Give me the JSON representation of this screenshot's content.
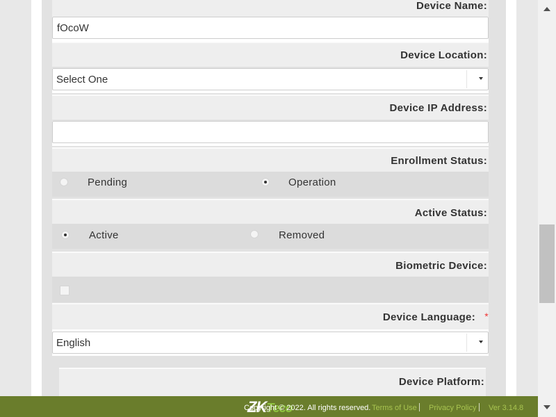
{
  "form": {
    "device_name": {
      "label": "Device Name:",
      "value": "fOcoW"
    },
    "device_location": {
      "label": "Device Location:",
      "selected": "Select One"
    },
    "device_ip": {
      "label": "Device IP Address:",
      "value": "",
      "placeholder": ""
    },
    "enrollment_status": {
      "label": "Enrollment Status:",
      "options": [
        "Pending",
        "Operation"
      ],
      "selected": "Operation"
    },
    "active_status": {
      "label": "Active Status:",
      "options": [
        "Active",
        "Removed"
      ],
      "selected": "Active"
    },
    "biometric_device": {
      "label": "Biometric Device:",
      "checked": false
    },
    "device_language": {
      "label": "Device Language:",
      "required_mark": "*",
      "selected": "English"
    },
    "device_platform": {
      "label": "Device Platform:"
    }
  },
  "footer": {
    "logo_main": "ZK",
    "logo_sub": "Teco",
    "copyright": "Copyright © 2022. All rights reserved.",
    "terms": "Terms of Use",
    "privacy": "Privacy Policy",
    "version": "Ver 3.14.8"
  },
  "colors": {
    "footer_bg": "#6a7d2c",
    "footer_link": "#a8c450",
    "required": "#e33333",
    "panel_bg": "#e2e2e2",
    "option_row_bg": "#dcdcdc"
  }
}
